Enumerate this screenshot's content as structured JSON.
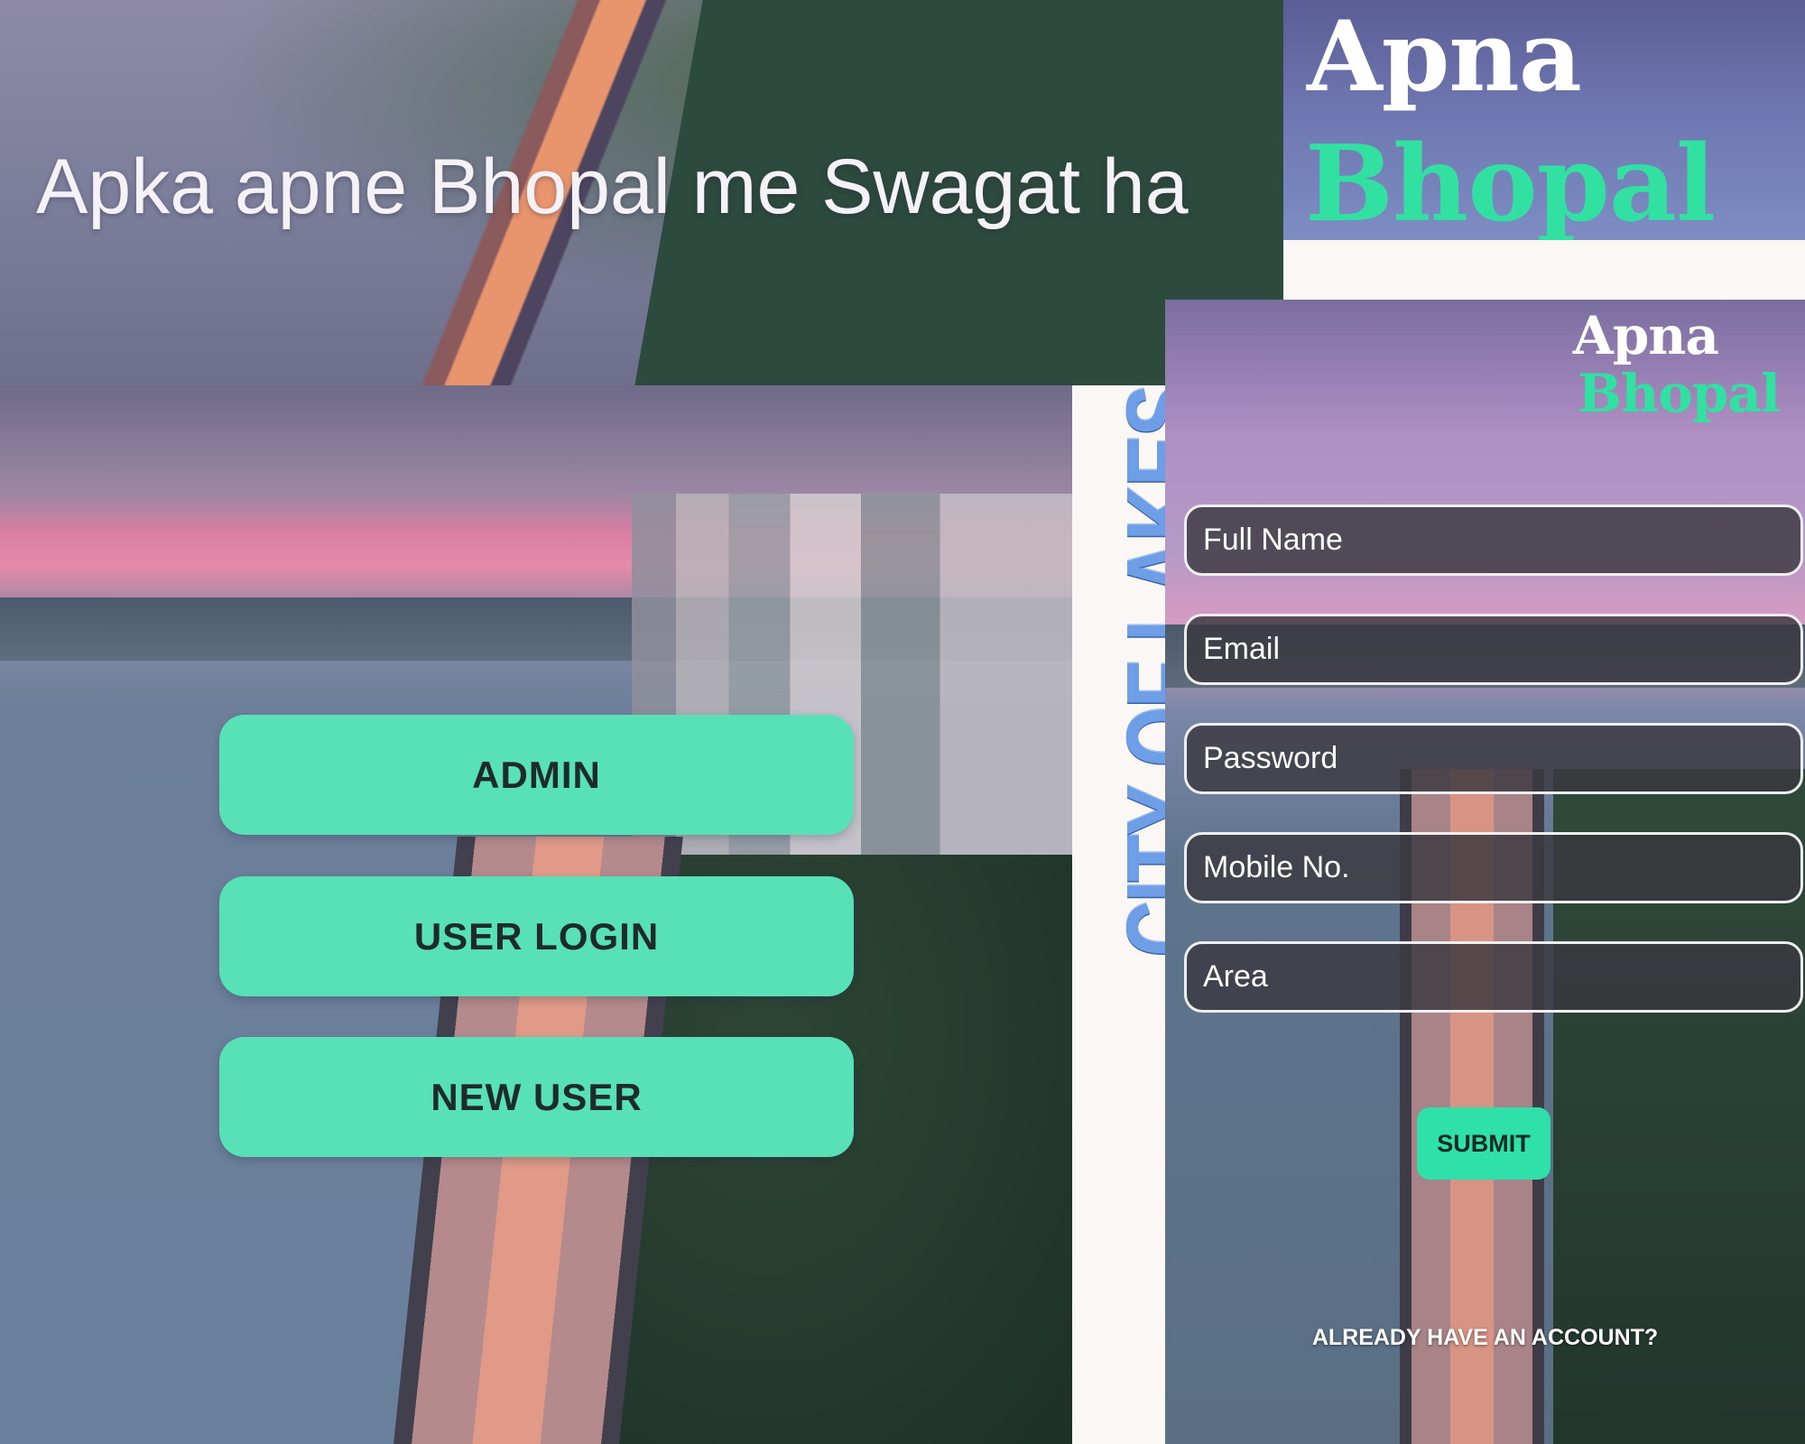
{
  "welcome_banner": {
    "text": "Apka apne Bhopal me Swagat ha"
  },
  "logo": {
    "line1": "Apna",
    "line2": "Bhopal"
  },
  "menu": {
    "admin_label": "ADMIN",
    "user_login_label": "USER LOGIN",
    "new_user_label": "NEW USER"
  },
  "tagline": "CITY OF LAKES",
  "register": {
    "logo_line1": "Apna",
    "logo_line2": "Bhopal",
    "fields": {
      "full_name": {
        "placeholder": "Full Name",
        "value": ""
      },
      "email": {
        "placeholder": "Email",
        "value": ""
      },
      "password": {
        "placeholder": "Password",
        "value": ""
      },
      "mobile": {
        "placeholder": "Mobile No.",
        "value": ""
      },
      "area": {
        "placeholder": "Area",
        "value": ""
      }
    },
    "submit_label": "SUBMIT",
    "have_account_label": "ALREADY HAVE AN ACCOUNT?"
  },
  "colors": {
    "accent_green": "#58e0b7",
    "logo_green": "#32e0a2",
    "tagline_blue": "#6e9ee6",
    "field_background": "#3a3840"
  }
}
